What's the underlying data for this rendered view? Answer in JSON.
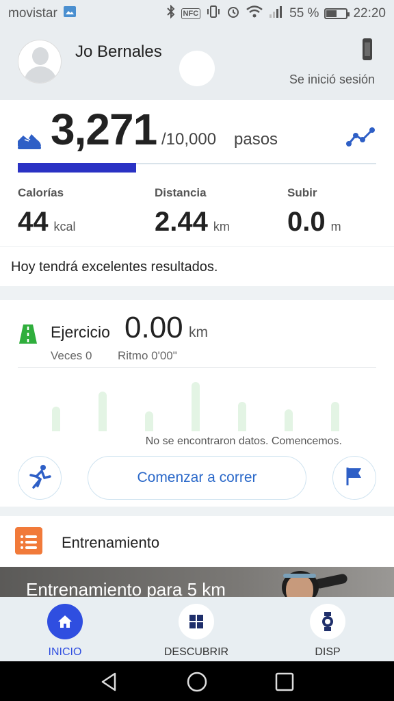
{
  "status_bar": {
    "carrier": "movistar",
    "nfc_label": "NFC",
    "battery_percent": "55 %",
    "battery_level": 0.55,
    "time": "22:20"
  },
  "profile": {
    "name": "Jo Bernales",
    "login_status": "Se inició sesión"
  },
  "steps": {
    "count": "3,271",
    "goal": "/10,000",
    "unit": "pasos",
    "progress": 0.33,
    "accent_color": "#2a32c4"
  },
  "stats": [
    {
      "label": "Calorías",
      "value": "44",
      "unit": "kcal"
    },
    {
      "label": "Distancia",
      "value": "2.44",
      "unit": "km"
    },
    {
      "label": "Subir",
      "value": "0.0",
      "unit": "m"
    }
  ],
  "message": "Hoy tendrá excelentes resultados.",
  "exercise": {
    "title": "Ejercicio",
    "distance": "0.00",
    "distance_unit": "km",
    "times": "Veces  0",
    "pace": "Ritmo  0'00\"",
    "bar_levels": [
      0.5,
      0.8,
      0.4,
      1.0,
      0.6,
      0.45,
      0.6
    ],
    "bar_color": "#e3f4e4",
    "no_data": "No se encontraron datos. Comencemos.",
    "start_button": "Comenzar a correr",
    "run_icon": "runner-icon",
    "flag_icon": "flag-icon"
  },
  "training": {
    "title": "Entrenamiento",
    "icon": "calendar-list-icon"
  },
  "banner": {
    "title": "Entrenamiento para 5 km"
  },
  "bottom_nav": [
    {
      "label": "INICIO",
      "icon": "home-icon",
      "active": true
    },
    {
      "label": "DESCUBRIR",
      "icon": "grid-icon",
      "active": false
    },
    {
      "label": "DISP",
      "icon": "watch-icon",
      "active": false
    }
  ]
}
